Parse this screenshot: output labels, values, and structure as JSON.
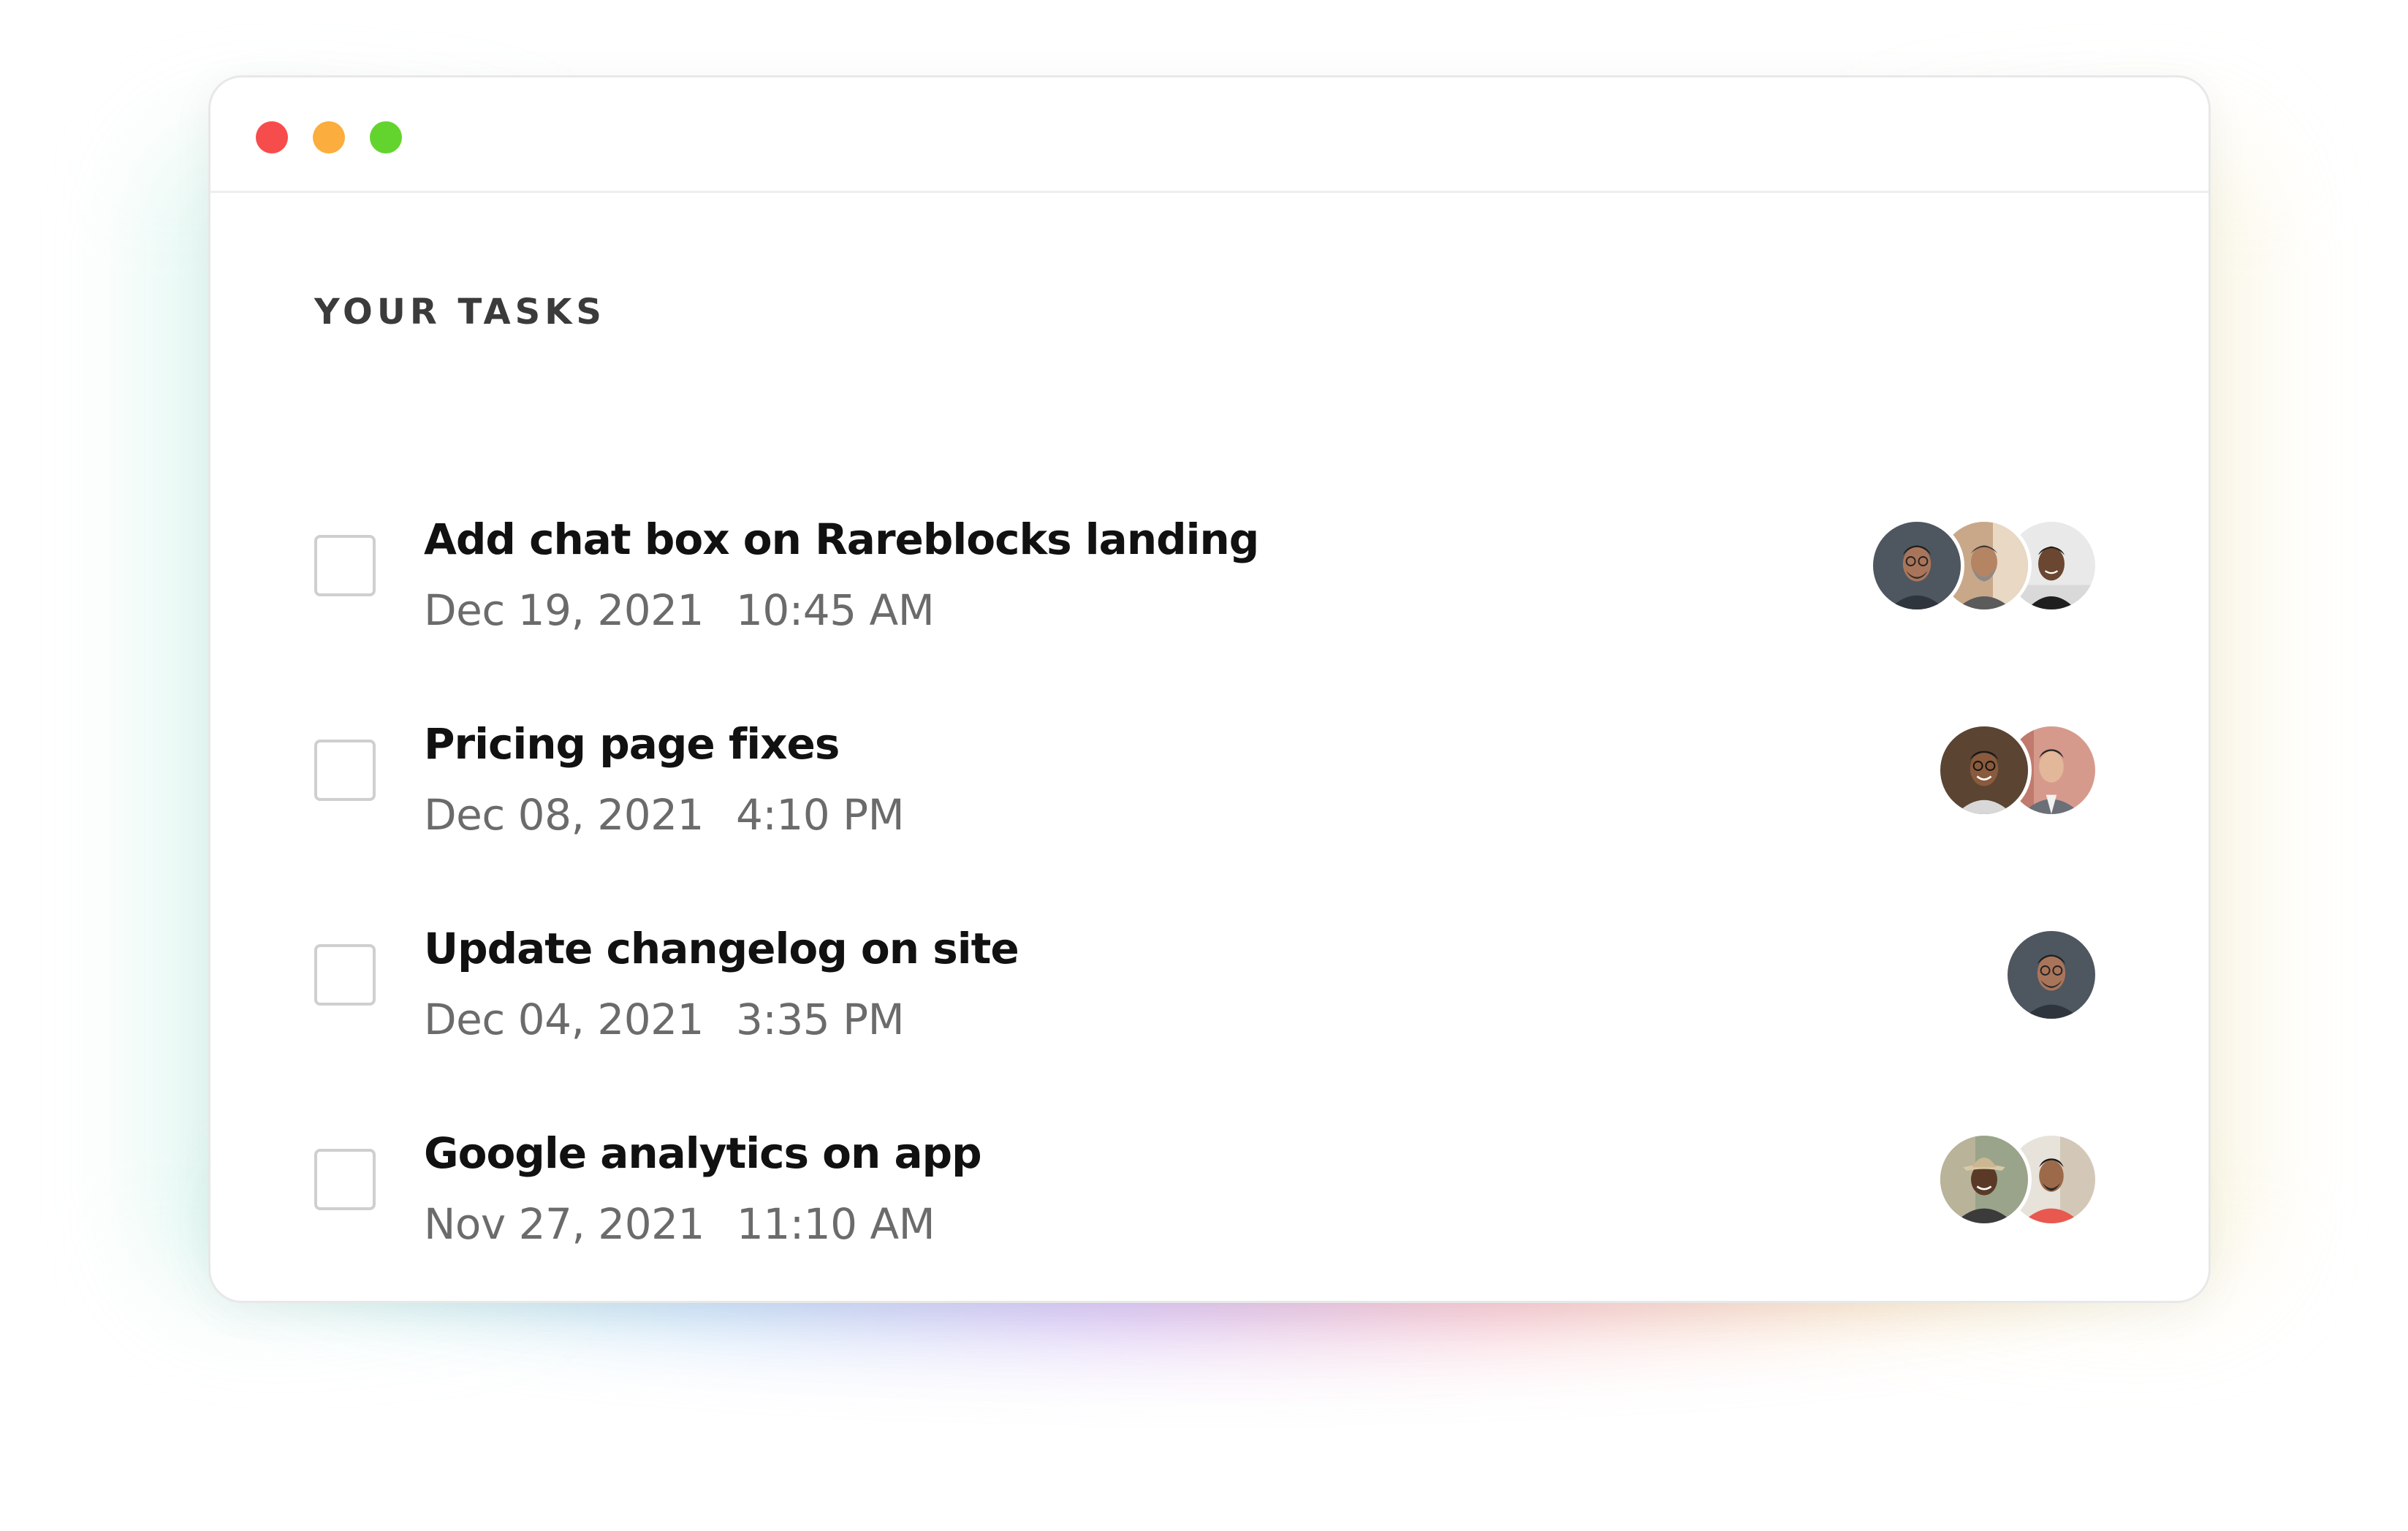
{
  "window": {
    "controls": [
      "close",
      "minimize",
      "maximize"
    ],
    "colors": {
      "close": "#f74c4c",
      "minimize": "#fbad3d",
      "maximize": "#63d42e"
    }
  },
  "section_title": "YOUR TASKS",
  "tasks": [
    {
      "title": "Add chat box on Rareblocks landing",
      "date": "Dec 19, 2021",
      "time": "10:45 AM",
      "checked": false,
      "assignees": [
        "avatar-man-glasses",
        "avatar-man-beard",
        "avatar-man-smiling"
      ]
    },
    {
      "title": "Pricing page fixes",
      "date": "Dec 08, 2021",
      "time": "4:10 PM",
      "checked": false,
      "assignees": [
        "avatar-man-glasses-smiling",
        "avatar-man-suit"
      ]
    },
    {
      "title": "Update changelog on site",
      "date": "Dec 04, 2021",
      "time": "3:35 PM",
      "checked": false,
      "assignees": [
        "avatar-man-glasses"
      ]
    },
    {
      "title": "Google analytics on app",
      "date": "Nov 27, 2021",
      "time": "11:10 AM",
      "checked": false,
      "assignees": [
        "avatar-man-hat",
        "avatar-man-red-shirt"
      ]
    }
  ]
}
